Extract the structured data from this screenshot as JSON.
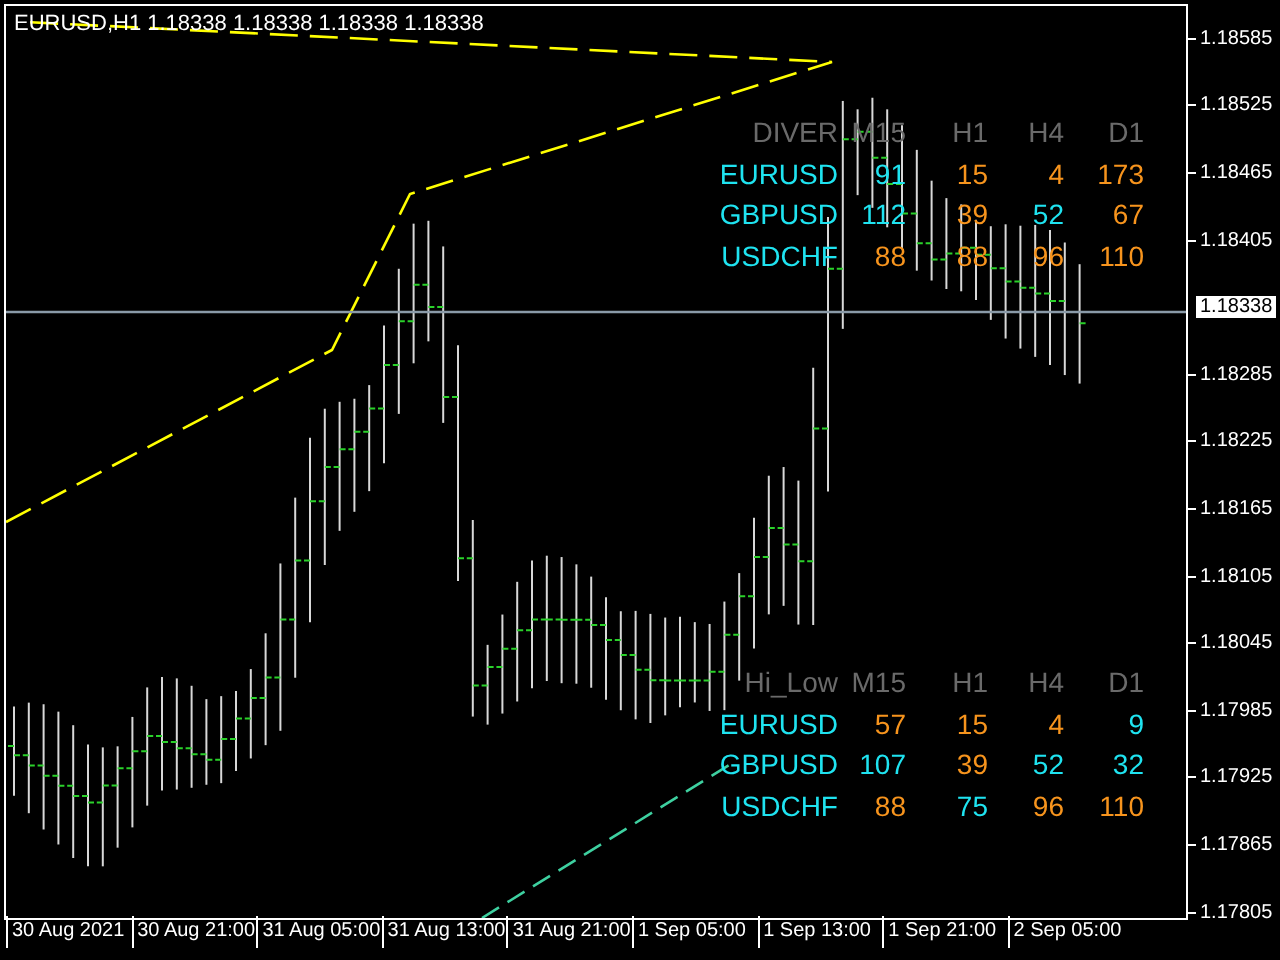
{
  "chart": {
    "title": "EURUSD,H1  1.18338 1.18338 1.18338 1.18338"
  },
  "price_axis": [
    {
      "label": "1.18585",
      "kind": "tick"
    },
    {
      "label": "1.18525",
      "kind": "tick"
    },
    {
      "label": "1.18465",
      "kind": "tick"
    },
    {
      "label": "1.18405",
      "kind": "tick"
    },
    {
      "label": "1.18338",
      "kind": "current"
    },
    {
      "label": "1.18285",
      "kind": "tick"
    },
    {
      "label": "1.18225",
      "kind": "tick"
    },
    {
      "label": "1.18165",
      "kind": "tick"
    },
    {
      "label": "1.18105",
      "kind": "tick"
    },
    {
      "label": "1.18045",
      "kind": "tick"
    },
    {
      "label": "1.17985",
      "kind": "tick"
    },
    {
      "label": "1.17925",
      "kind": "tick"
    },
    {
      "label": "1.17865",
      "kind": "tick"
    },
    {
      "label": "1.17805",
      "kind": "tick"
    }
  ],
  "time_axis": [
    "30 Aug 2021",
    "30 Aug 21:00",
    "31 Aug 05:00",
    "31 Aug 13:00",
    "31 Aug 21:00",
    "1 Sep 05:00",
    "1 Sep 13:00",
    "1 Sep 21:00",
    "2 Sep 05:00"
  ],
  "tables": [
    {
      "title": "DIVER",
      "columns": [
        "M15",
        "H1",
        "H4",
        "D1"
      ],
      "rows": [
        {
          "symbol": "EURUSD",
          "cells": [
            {
              "text": "91",
              "color": "#1fe3f0"
            },
            {
              "text": "15",
              "color": "#f7941d"
            },
            {
              "text": "4",
              "color": "#f7941d"
            },
            {
              "text": "173",
              "color": "#f7941d"
            }
          ]
        },
        {
          "symbol": "GBPUSD",
          "cells": [
            {
              "text": "112",
              "color": "#1fe3f0"
            },
            {
              "text": "39",
              "color": "#f7941d"
            },
            {
              "text": "52",
              "color": "#1fe3f0"
            },
            {
              "text": "67",
              "color": "#f7941d"
            }
          ]
        },
        {
          "symbol": "USDCHF",
          "cells": [
            {
              "text": "88",
              "color": "#f7941d"
            },
            {
              "text": "88",
              "color": "#f7941d"
            },
            {
              "text": "96",
              "color": "#f7941d"
            },
            {
              "text": "110",
              "color": "#f7941d"
            }
          ]
        }
      ]
    },
    {
      "title": "Hi_Low",
      "columns": [
        "M15",
        "H1",
        "H4",
        "D1"
      ],
      "rows": [
        {
          "symbol": "EURUSD",
          "cells": [
            {
              "text": "57",
              "color": "#f7941d"
            },
            {
              "text": "15",
              "color": "#f7941d"
            },
            {
              "text": "4",
              "color": "#f7941d"
            },
            {
              "text": "9",
              "color": "#1fe3f0"
            }
          ]
        },
        {
          "symbol": "GBPUSD",
          "cells": [
            {
              "text": "107",
              "color": "#1fe3f0"
            },
            {
              "text": "39",
              "color": "#f7941d"
            },
            {
              "text": "52",
              "color": "#1fe3f0"
            },
            {
              "text": "32",
              "color": "#1fe3f0"
            }
          ]
        },
        {
          "symbol": "USDCHF",
          "cells": [
            {
              "text": "88",
              "color": "#f7941d"
            },
            {
              "text": "75",
              "color": "#1fe3f0"
            },
            {
              "text": "96",
              "color": "#f7941d"
            },
            {
              "text": "110",
              "color": "#f7941d"
            }
          ]
        }
      ]
    }
  ]
}
